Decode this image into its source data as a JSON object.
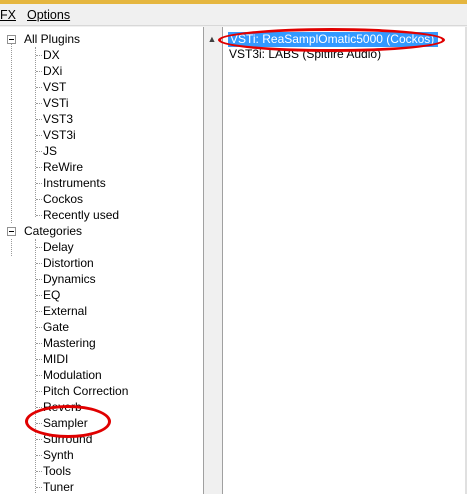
{
  "menu": {
    "fx_label": "FX",
    "options_label": "Options"
  },
  "tree": {
    "all_plugins": {
      "label": "All Plugins",
      "children": [
        "DX",
        "DXi",
        "VST",
        "VSTi",
        "VST3",
        "VST3i",
        "JS",
        "ReWire",
        "Instruments",
        "Cockos",
        "Recently used"
      ]
    },
    "categories": {
      "label": "Categories",
      "children": [
        "Delay",
        "Distortion",
        "Dynamics",
        "EQ",
        "External",
        "Gate",
        "Mastering",
        "MIDI",
        "Modulation",
        "Pitch Correction",
        "Reverb",
        "Sampler",
        "Surround",
        "Synth",
        "Tools",
        "Tuner"
      ]
    }
  },
  "scroll": {
    "up_arrow": "▲"
  },
  "plugin_list": [
    {
      "label": "VSTi: ReaSamplOmatic5000 (Cockos)",
      "selected": true
    },
    {
      "label": "VST3i: LABS (Spitfire Audio)",
      "selected": false
    }
  ],
  "annotation_color": "#e00000",
  "selection_color": "#3399ff"
}
